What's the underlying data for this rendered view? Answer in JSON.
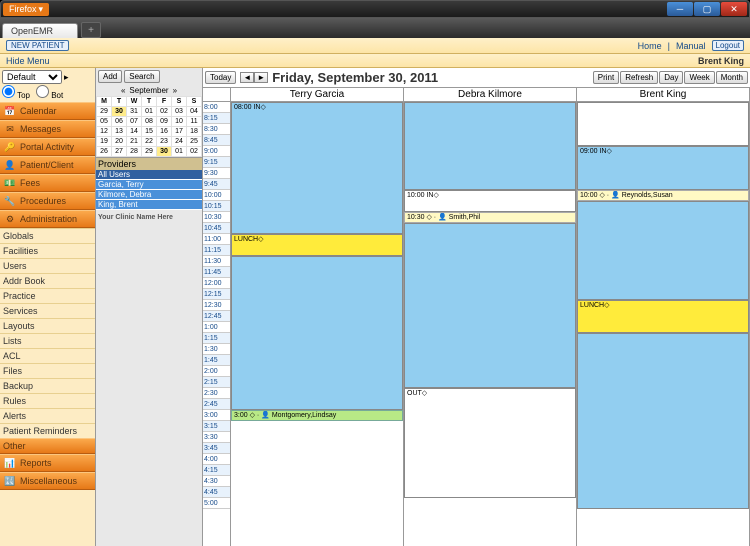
{
  "window": {
    "firefox": "Firefox",
    "tab": "OpenEMR"
  },
  "topbar": {
    "new_patient": "NEW PATIENT",
    "home": "Home",
    "manual": "Manual",
    "logout": "Logout"
  },
  "namebar": {
    "hide_menu": "Hide Menu",
    "user": "Brent King"
  },
  "sidebar": {
    "default": "Default",
    "top": "Top",
    "bot": "Bot",
    "main": [
      {
        "icon": "📅",
        "label": "Calendar"
      },
      {
        "icon": "✉",
        "label": "Messages"
      },
      {
        "icon": "🔑",
        "label": "Portal Activity"
      },
      {
        "icon": "👤",
        "label": "Patient/Client"
      },
      {
        "icon": "💵",
        "label": "Fees"
      },
      {
        "icon": "🔧",
        "label": "Procedures"
      },
      {
        "icon": "⚙",
        "label": "Administration"
      }
    ],
    "admin": [
      "Globals",
      "Facilities",
      "Users",
      "Addr Book",
      "Practice",
      "Services",
      "Layouts",
      "Lists",
      "ACL",
      "Files",
      "Backup",
      "Rules",
      "Alerts",
      "Patient Reminders"
    ],
    "other_hdr": "Other",
    "other": [
      {
        "icon": "📊",
        "label": "Reports"
      },
      {
        "icon": "🔣",
        "label": "Miscellaneous"
      }
    ]
  },
  "midcol": {
    "add": "Add",
    "search": "Search",
    "today": "Today",
    "month": "September",
    "dows": [
      "M",
      "T",
      "W",
      "T",
      "F",
      "S",
      "S"
    ],
    "weeks": [
      [
        "29",
        "30",
        "31",
        "01",
        "02",
        "03",
        "04"
      ],
      [
        "05",
        "06",
        "07",
        "08",
        "09",
        "10",
        "11"
      ],
      [
        "12",
        "13",
        "14",
        "15",
        "16",
        "17",
        "18"
      ],
      [
        "19",
        "20",
        "21",
        "22",
        "23",
        "24",
        "25"
      ],
      [
        "26",
        "27",
        "28",
        "29",
        "30",
        "01",
        "02"
      ]
    ],
    "today_cell": "30",
    "providers_hdr": "Providers",
    "providers": [
      "All Users",
      "Garcia, Terry",
      "Kilmore, Debra",
      "King, Brent"
    ],
    "clinic": "Your Clinic Name Here"
  },
  "sched": {
    "date": "Friday, September 30, 2011",
    "btns": {
      "print": "Print",
      "refresh": "Refresh",
      "day": "Day",
      "week": "Week",
      "month": "Month"
    },
    "times": [
      "8:00",
      "8:15",
      "8:30",
      "8:45",
      "9:00",
      "9:15",
      "9:30",
      "9:45",
      "10:00",
      "10:15",
      "10:30",
      "10:45",
      "11:00",
      "11:15",
      "11:30",
      "11:45",
      "12:00",
      "12:15",
      "12:30",
      "12:45",
      "1:00",
      "1:15",
      "1:30",
      "1:45",
      "2:00",
      "2:15",
      "2:30",
      "2:45",
      "3:00",
      "3:15",
      "3:30",
      "3:45",
      "4:00",
      "4:15",
      "4:30",
      "4:45",
      "5:00"
    ],
    "cols": [
      {
        "name": "Terry Garcia",
        "events": [
          {
            "t": 0,
            "h": 12,
            "cls": "in",
            "txt": "08:00 IN◇"
          },
          {
            "t": 12,
            "h": 2,
            "cls": "lunch",
            "txt": "LUNCH◇"
          },
          {
            "t": 14,
            "h": 14,
            "cls": "in",
            "txt": ""
          },
          {
            "t": 28,
            "h": 1,
            "cls": "appt2",
            "txt": "3:00 ◇ · 👤 Montgomery,Lindsay"
          }
        ]
      },
      {
        "name": "Debra Kilmore",
        "events": [
          {
            "t": 0,
            "h": 8,
            "cls": "in",
            "txt": ""
          },
          {
            "t": 8,
            "h": 2,
            "cls": "out",
            "txt": "10:00 IN◇"
          },
          {
            "t": 10,
            "h": 1,
            "cls": "appt",
            "txt": "10:30 ◇ · 👤 Smith,Phil"
          },
          {
            "t": 11,
            "h": 15,
            "cls": "in",
            "txt": ""
          },
          {
            "t": 26,
            "h": 10,
            "cls": "out",
            "txt": "OUT◇"
          }
        ]
      },
      {
        "name": "Brent King",
        "events": [
          {
            "t": 0,
            "h": 4,
            "cls": "out",
            "txt": ""
          },
          {
            "t": 4,
            "h": 4,
            "cls": "in",
            "txt": "09:00 IN◇"
          },
          {
            "t": 8,
            "h": 1,
            "cls": "appt",
            "txt": "10:00 ◇ · 👤 Reynolds,Susan"
          },
          {
            "t": 9,
            "h": 9,
            "cls": "in",
            "txt": ""
          },
          {
            "t": 18,
            "h": 3,
            "cls": "lunch",
            "txt": "LUNCH◇"
          },
          {
            "t": 21,
            "h": 16,
            "cls": "in",
            "txt": ""
          }
        ]
      }
    ]
  }
}
